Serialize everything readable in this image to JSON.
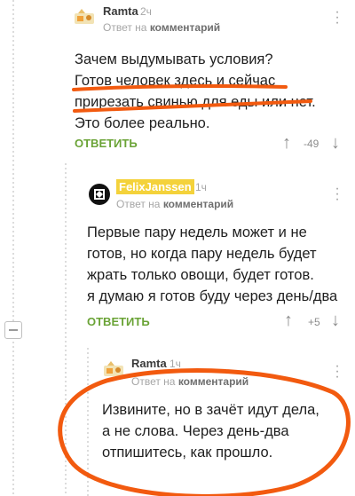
{
  "comments": [
    {
      "author": "Ramta",
      "time": "2ч",
      "reply_prefix": "Ответ на",
      "reply_target": "комментарий",
      "lines": [
        "Зачем выдумывать условия?",
        "Готов человек здесь и сейчас",
        "прирезать свинью для еды или нет.",
        "Это более реально."
      ],
      "reply_label": "ОТВЕТИТЬ",
      "votes": "-49"
    },
    {
      "author": "FelixJanssen",
      "time": "1ч",
      "reply_prefix": "Ответ на",
      "reply_target": "комментарий",
      "lines": [
        "Первые пару недель может и не",
        "готов, но когда пару недель будет",
        "жрать только овощи, будет готов.",
        "я думаю я готов буду через день/два"
      ],
      "reply_label": "ОТВЕТИТЬ",
      "votes": "+5"
    },
    {
      "author": "Ramta",
      "time": "1ч",
      "reply_prefix": "Ответ на",
      "reply_target": "комментарий",
      "lines": [
        "Извините, но в зачёт идут дела,",
        "а не слова. Через день-два",
        "отпишитесь, как прошло."
      ]
    }
  ],
  "colors": {
    "accent_green": "#6aa336",
    "markup_orange": "#f25a0f",
    "badge_yellow": "#f4d23b"
  }
}
